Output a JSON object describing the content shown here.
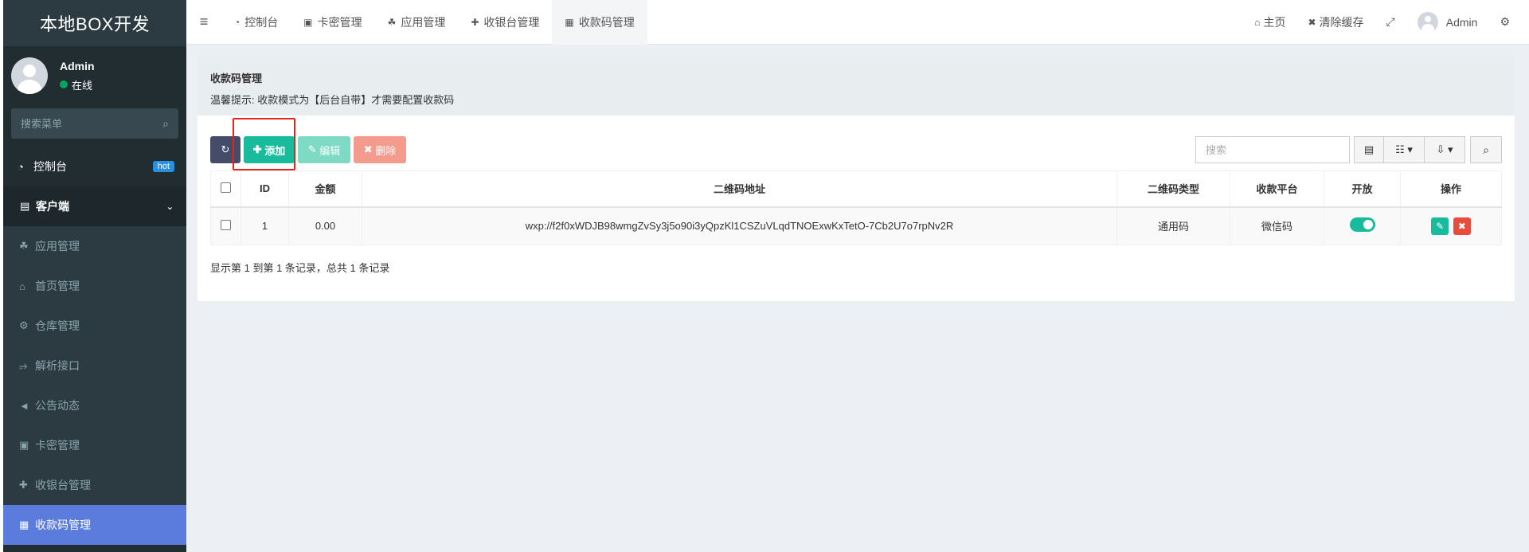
{
  "sidebar": {
    "logo": "本地BOX开发",
    "user_name": "Admin",
    "user_status": "在线",
    "search_placeholder": "搜索菜单",
    "items": [
      {
        "label": "控制台",
        "icon": "dashboard-icon",
        "badge": "hot"
      },
      {
        "label": "客户端",
        "icon": "inbox-icon"
      },
      {
        "label": "应用管理",
        "icon": "android-icon"
      },
      {
        "label": "首页管理",
        "icon": "home-icon"
      },
      {
        "label": "仓库管理",
        "icon": "cogs-icon"
      },
      {
        "label": "解析接口",
        "icon": "usb-icon"
      },
      {
        "label": "公告动态",
        "icon": "bullhorn-icon"
      },
      {
        "label": "卡密管理",
        "icon": "id-card-icon"
      },
      {
        "label": "收银台管理",
        "icon": "user-plus-icon"
      },
      {
        "label": "收款码管理",
        "icon": "qrcode-icon"
      }
    ]
  },
  "topbar": {
    "tabs": [
      "控制台",
      "卡密管理",
      "应用管理",
      "收银台管理",
      "收款码管理"
    ],
    "home": "主页",
    "clear_cache": "清除缓存",
    "user": "Admin"
  },
  "panel": {
    "title": "收款码管理",
    "tip": "温馨提示: 收款模式为【后台自带】才需要配置收款码"
  },
  "toolbar": {
    "add": "添加",
    "edit": "编辑",
    "delete": "删除",
    "search_placeholder": "搜索"
  },
  "table": {
    "headers": [
      "ID",
      "金额",
      "二维码地址",
      "二维码类型",
      "收款平台",
      "开放",
      "操作"
    ],
    "rows": [
      {
        "id": "1",
        "amount": "0.00",
        "qrcode": "wxp://f2f0xWDJB98wmgZvSy3j5o90i3yQpzKl1CSZuVLqdTNOExwKxTetO-7Cb2U7o7rpNv2R",
        "type": "通用码",
        "platform": "微信码",
        "open": true
      }
    ]
  },
  "footer": "显示第 1 到第 1 条记录，总共 1 条记录",
  "colors": {
    "sidebar_bg": "#222d32",
    "active_menu": "#5b7bdd",
    "success": "#18bc9c",
    "danger": "#e74c3c",
    "highlight": "#e3241b"
  }
}
